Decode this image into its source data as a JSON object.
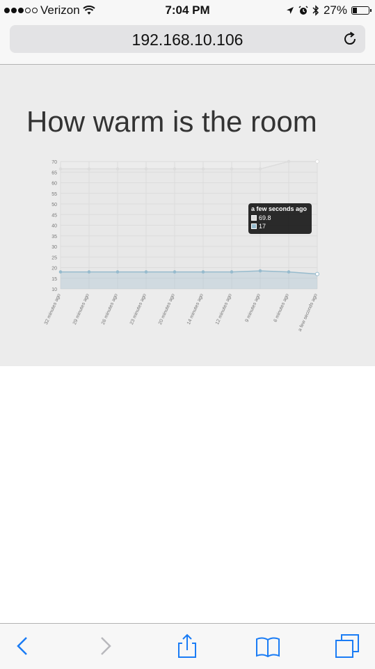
{
  "status_bar": {
    "carrier": "Verizon",
    "time": "7:04 PM",
    "battery_percent": "27%",
    "battery_level": 0.27
  },
  "address_bar": {
    "url": "192.168.10.106"
  },
  "page": {
    "title": "How warm is the room"
  },
  "chart_data": {
    "type": "line",
    "title": "",
    "xlabel": "",
    "ylabel": "",
    "ylim": [
      10,
      70
    ],
    "y_ticks": [
      10,
      15,
      20,
      25,
      30,
      35,
      40,
      45,
      50,
      55,
      60,
      65,
      70
    ],
    "categories": [
      "32 minutes ago",
      "29 minutes ago",
      "26 minutes ago",
      "23 minutes ago",
      "20 minutes ago",
      "14 minutes ago",
      "12 minutes ago",
      "9 minutes ago",
      "6 minutes ago",
      "a few seconds ago"
    ],
    "series": [
      {
        "values": [
          66.5,
          66.5,
          66.5,
          66.5,
          66.5,
          66.5,
          66.5,
          66.5,
          70,
          70
        ],
        "color": "#dcdcdc"
      },
      {
        "values": [
          18,
          18,
          18,
          18,
          18,
          18,
          18,
          18.5,
          18,
          17
        ],
        "color": "#97bbcd"
      }
    ],
    "grid": true,
    "tooltip": {
      "title": "a few seconds ago",
      "rows": [
        "69.8",
        "17"
      ]
    }
  },
  "toolbar": {
    "buttons": [
      "back-icon",
      "forward-icon",
      "share-icon",
      "bookmarks-icon",
      "tabs-icon"
    ]
  },
  "colors": {
    "ios_blue": "#1a7cf5",
    "page_bg": "#ececec"
  }
}
